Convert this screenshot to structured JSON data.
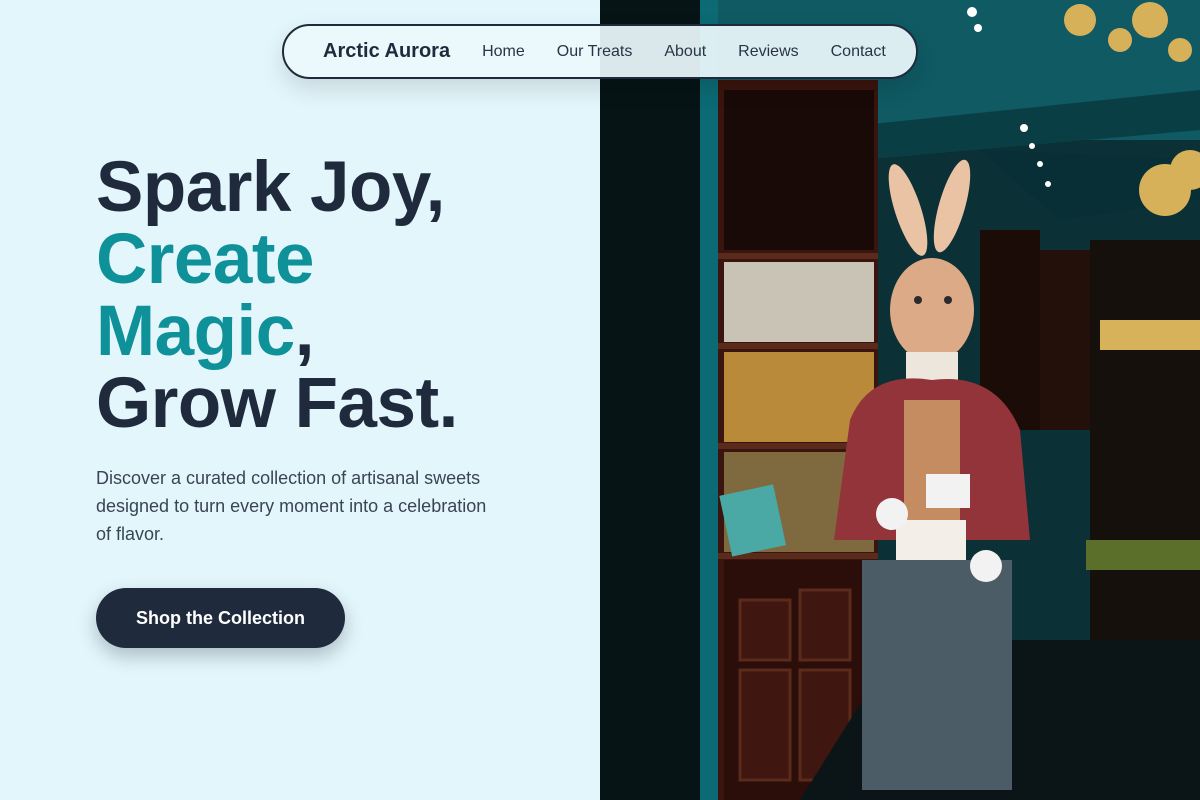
{
  "nav": {
    "brand": "Arctic Aurora",
    "links": [
      "Home",
      "Our Treats",
      "About",
      "Reviews",
      "Contact"
    ]
  },
  "hero": {
    "line1": "Spark Joy,",
    "line2": "Create",
    "line3_accent": "Magic",
    "line3_rest": ",",
    "line4": "Grow Fast.",
    "description": "Discover a curated collection of artisanal sweets designed to turn every moment into a celebration of flavor.",
    "cta": "Shop the Collection"
  },
  "colors": {
    "background": "#e3f6fb",
    "dark": "#1f2a3c",
    "accent": "#0e9199"
  },
  "icons": [
    "hero-shop-photo"
  ]
}
